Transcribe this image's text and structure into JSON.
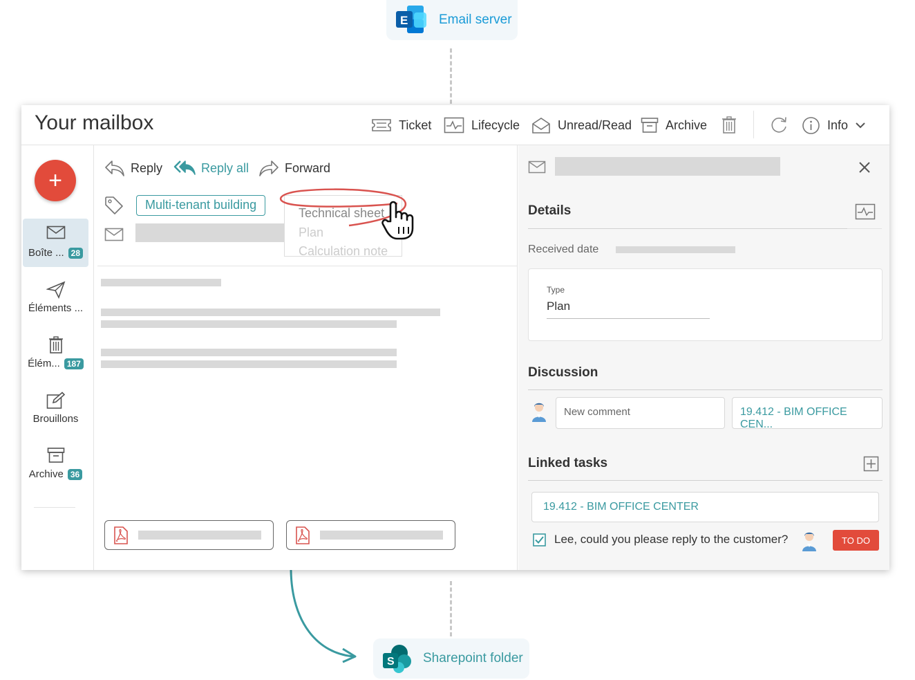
{
  "email_server": {
    "label": "Email server"
  },
  "sharepoint": {
    "label": "Sharepoint folder"
  },
  "window": {
    "title": "Your mailbox"
  },
  "toolbar": {
    "ticket": "Ticket",
    "lifecycle": "Lifecycle",
    "unread_read": "Unread/Read",
    "archive": "Archive",
    "info": "Info"
  },
  "sidebar": {
    "items": [
      {
        "label": "Boîte ...",
        "count": "28"
      },
      {
        "label": "Éléments ...",
        "count": ""
      },
      {
        "label": "Élém...",
        "count": "187"
      },
      {
        "label": "Brouillons",
        "count": ""
      },
      {
        "label": "Archive",
        "count": "36"
      }
    ]
  },
  "message": {
    "reply": "Reply",
    "reply_all": "Reply all",
    "forward": "Forward",
    "tag": "Multi-tenant building",
    "tag_options": [
      "Technical sheet",
      "Plan",
      "Calculation note"
    ]
  },
  "details": {
    "title": "Details",
    "received_label": "Received date",
    "type_label": "Type",
    "type_value": "Plan"
  },
  "discussion": {
    "title": "Discussion",
    "comment_placeholder": "New comment",
    "project": "19.412 - BIM OFFICE CEN..."
  },
  "linked_tasks": {
    "title": "Linked tasks",
    "project": "19.412 - BIM OFFICE CENTER",
    "task_text": "Lee, could you please reply to the customer?",
    "status": "TO DO"
  },
  "colors": {
    "teal": "#3a9aa0",
    "red": "#e24b3b",
    "exchange_blue": "#1a9bd7"
  }
}
